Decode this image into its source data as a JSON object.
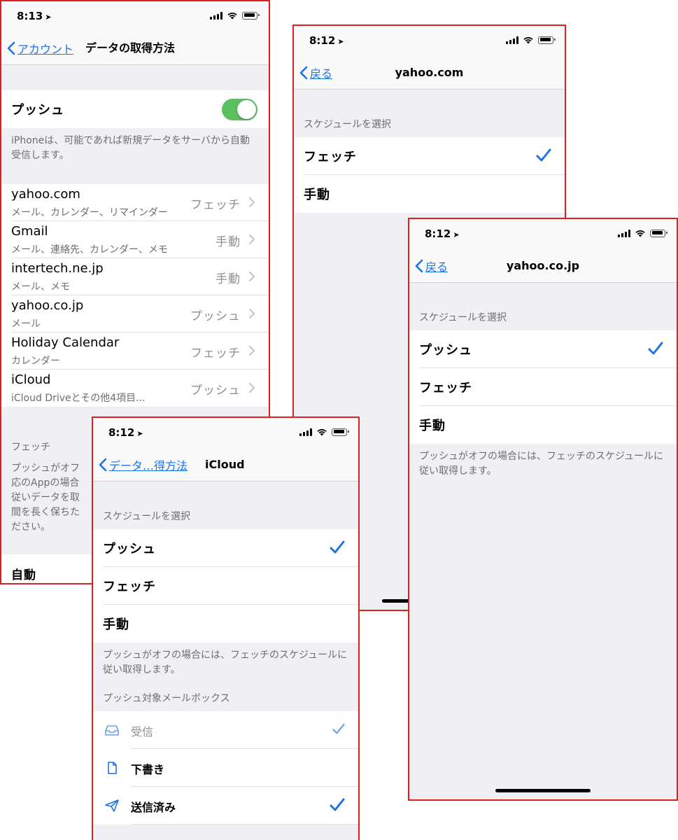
{
  "screen1": {
    "time": "8:13",
    "back_label": "アカウント",
    "title": "データの取得方法",
    "push_label": "プッシュ",
    "push_on": true,
    "push_note": "iPhoneは、可能であれば新規データをサーバから自動受信します。",
    "accounts": [
      {
        "name": "yahoo.com",
        "sub": "メール、カレンダー、リマインダー",
        "value": "フェッチ"
      },
      {
        "name": "Gmail",
        "sub": "メール、連絡先、カレンダー、メモ",
        "value": "手動"
      },
      {
        "name": "intertech.ne.jp",
        "sub": "メール、メモ",
        "value": "手動"
      },
      {
        "name": "yahoo.co.jp",
        "sub": "メール",
        "value": "プッシュ"
      },
      {
        "name": "Holiday Calendar",
        "sub": "カレンダー",
        "value": "フェッチ"
      },
      {
        "name": "iCloud",
        "sub": "iCloud Driveとその他4項目...",
        "value": "プッシュ"
      }
    ],
    "fetch_header": "フェッチ",
    "fetch_note_lines": [
      "プッシュがオフ",
      "応のAppの場合",
      "従いデータを取",
      "間を長く保ちた",
      "ださい。"
    ],
    "auto_label": "自動"
  },
  "screen2": {
    "time": "8:12",
    "back_label": "戻る",
    "title": "yahoo.com",
    "section_header": "スケジュールを選択",
    "options": [
      "フェッチ",
      "手動"
    ],
    "selected": 0
  },
  "screen3": {
    "time": "8:12",
    "back_label": "戻る",
    "title": "yahoo.co.jp",
    "section_header": "スケジュールを選択",
    "options": [
      "プッシュ",
      "フェッチ",
      "手動"
    ],
    "selected": 0,
    "note": "プッシュがオフの場合には、フェッチのスケジュールに従い取得します。"
  },
  "screen4": {
    "time": "8:12",
    "back_label": "データ…得方法",
    "title": "iCloud",
    "section_header": "スケジュールを選択",
    "options": [
      "プッシュ",
      "フェッチ",
      "手動"
    ],
    "selected": 0,
    "note": "プッシュがオフの場合には、フェッチのスケジュールに従い取得します。",
    "mailbox_header": "プッシュ対象メールボックス",
    "mailboxes": [
      {
        "label": "受信",
        "icon": "inbox-icon",
        "checked": true,
        "dim": true
      },
      {
        "label": "下書き",
        "icon": "document-icon",
        "checked": false,
        "dim": false
      },
      {
        "label": "送信済み",
        "icon": "paper-plane-icon",
        "checked": true,
        "dim": false
      }
    ]
  },
  "colors": {
    "accent": "#1a73e8",
    "toggle_on": "#5cbf60",
    "frame": "#e02020",
    "group_bg": "#efeff4"
  }
}
